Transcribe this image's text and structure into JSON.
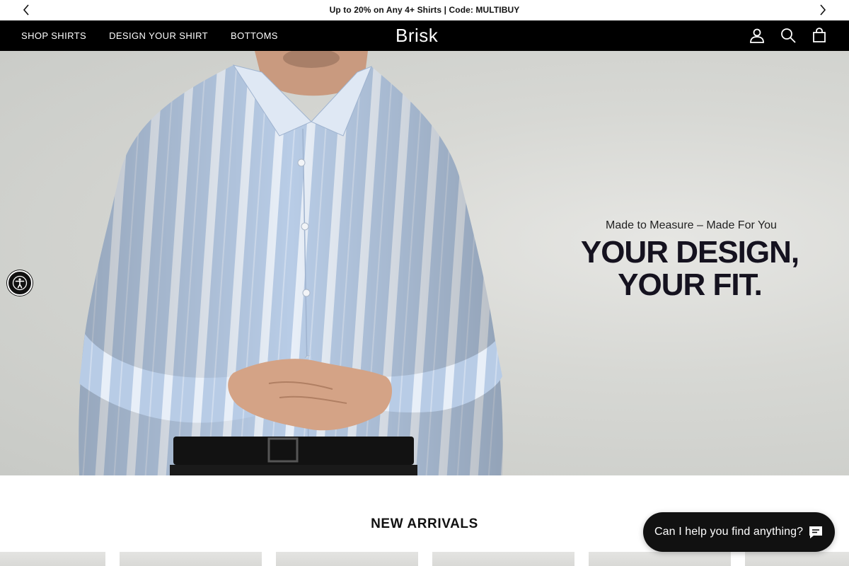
{
  "announcement": {
    "text": "Up to 20% on Any 4+ Shirts | Code: MULTIBUY",
    "prev_icon": "chevron-left-icon",
    "next_icon": "chevron-right-icon"
  },
  "nav": {
    "links": [
      {
        "label": "SHOP SHIRTS"
      },
      {
        "label": "DESIGN YOUR SHIRT"
      },
      {
        "label": "BOTTOMS"
      }
    ],
    "logo": "Brisk",
    "icons": [
      "account-icon",
      "search-icon",
      "cart-icon"
    ]
  },
  "hero": {
    "tagline": "Made to Measure – Made For You",
    "heading_line1": "YOUR DESIGN,",
    "heading_line2": "YOUR FIT.",
    "image": "man-in-blue-striped-shirt"
  },
  "accessibility": {
    "icon": "accessibility-icon"
  },
  "new_arrivals": {
    "title": "NEW ARRIVALS",
    "cards_visible": 6
  },
  "chat": {
    "text": "Can I help you find anything?",
    "icon": "chat-bubble-icon"
  },
  "colors": {
    "nav_bg": "#000000",
    "hero_bg": "#d4d5d1",
    "shirt_blue": "#b9cde6",
    "heading": "#15121f"
  }
}
